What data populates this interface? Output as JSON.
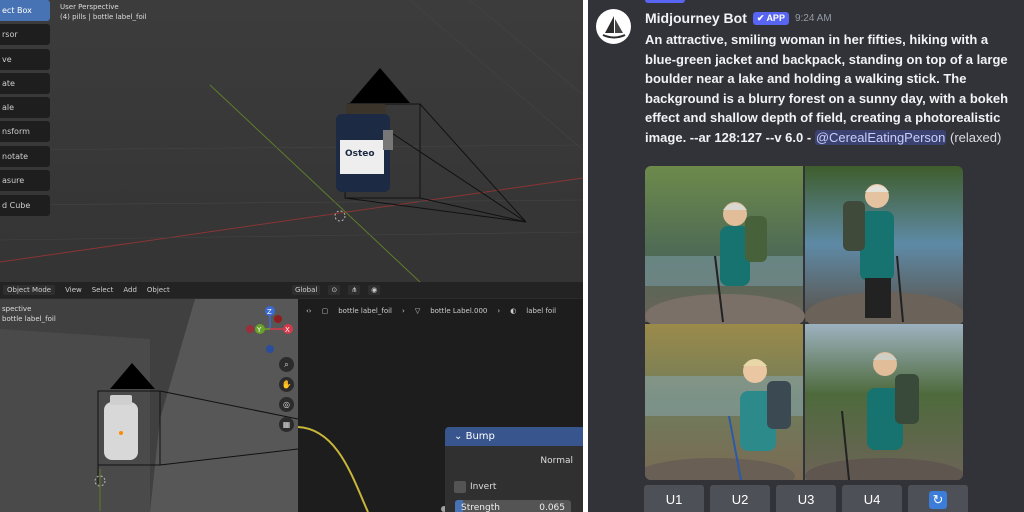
{
  "blender": {
    "tools": [
      "ect Box",
      "rsor",
      "ve",
      "ate",
      "ale",
      "nsform",
      "notate",
      "asure",
      "d Cube"
    ],
    "overlay_top": [
      "User Perspective",
      "(4) pills | bottle label_foil"
    ],
    "header": {
      "mode": "Object Mode",
      "menus": [
        "View",
        "Select",
        "Add",
        "Object"
      ],
      "transform": "Global"
    },
    "overlay_bottom": [
      "spective",
      "bottle label_foil"
    ],
    "breadcrumbs": [
      "bottle label_foil",
      "bottle Label.000",
      "label foil"
    ],
    "bump_node": {
      "title": "Bump",
      "output": "Normal",
      "invert_label": "Invert",
      "strength_label": "Strength",
      "strength_value": "0.065",
      "strength_fill": 0.065
    },
    "gizmo_axes": [
      "Z",
      "X",
      "Y"
    ],
    "bottle_label": "Osteo"
  },
  "discord": {
    "bot_name": "Midjourney Bot",
    "badge": "APP",
    "time": "9:24 AM",
    "prompt": "An attractive, smiling woman in her fifties, hiking with a blue-green jacket and backpack, standing on top of a large boulder near a lake and holding a walking stick. The background is a blurry forest on a sunny day, with a bokeh effect and shallow depth of field, creating a photorealistic image. --ar 128:127 --v 6.0 -",
    "mention": "@CerealEatingPerson",
    "status": "(relaxed)",
    "buttons": [
      "U1",
      "U2",
      "U3",
      "U4"
    ]
  },
  "colors": {
    "blender_active": "#4772b3",
    "discord_bg": "#313338",
    "discord_blurple": "#5865f2",
    "node_header": "#39558d"
  }
}
